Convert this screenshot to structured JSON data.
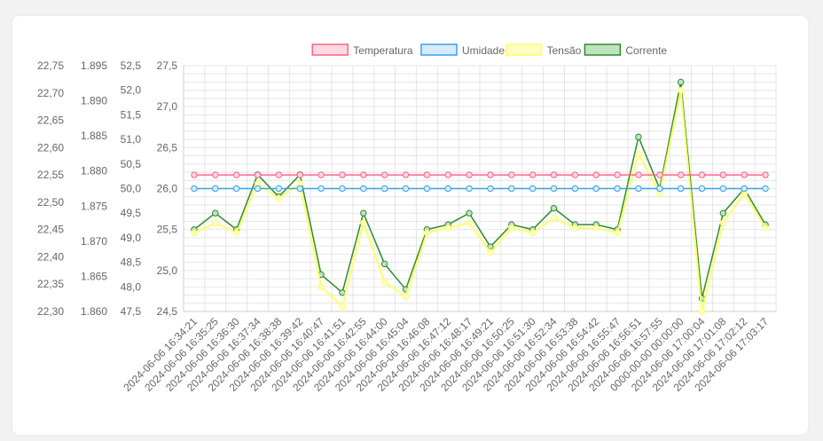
{
  "chart_data": {
    "type": "line",
    "title": "",
    "legend_position": "top",
    "grid": true,
    "categories": [
      "2024-06-06 16:34:21",
      "2024-06-06 16:35:25",
      "2024-06-06 16:36:30",
      "2024-06-06 16:37:34",
      "2024-06-06 16:38:38",
      "2024-06-06 16:39:42",
      "2024-06-06 16:40:47",
      "2024-06-06 16:41:51",
      "2024-06-06 16:42:55",
      "2024-06-06 16:44:00",
      "2024-06-06 16:45:04",
      "2024-06-06 16:46:08",
      "2024-06-06 16:47:12",
      "2024-06-06 16:48:17",
      "2024-06-06 16:49:21",
      "2024-06-06 16:50:25",
      "2024-06-06 16:51:30",
      "2024-06-06 16:52:34",
      "2024-06-06 16:53:38",
      "2024-06-06 16:54:42",
      "2024-06-06 16:55:47",
      "2024-06-06 16:56:51",
      "2024-06-06 16:57:55",
      "0000-00-00 00:00:00",
      "2024-06-06 17:00:04",
      "2024-06-06 17:01:08",
      "2024-06-06 17:02:12",
      "2024-06-06 17:03:17"
    ],
    "axes": [
      {
        "id": "y_temp",
        "ticks": [
          "22,75",
          "22,70",
          "22,65",
          "22,60",
          "22,55",
          "22,50",
          "22,45",
          "22,40",
          "22,35",
          "22,30"
        ],
        "ylim": [
          22.3,
          22.75
        ]
      },
      {
        "id": "y_umid",
        "ticks": [
          "1.895",
          "1.890",
          "1.885",
          "1.880",
          "1.875",
          "1.870",
          "1.865",
          "1.860"
        ],
        "ylim": [
          1.86,
          1.895
        ]
      },
      {
        "id": "y_tensao",
        "ticks": [
          "52,5",
          "52,0",
          "51,5",
          "51,0",
          "50,5",
          "50,0",
          "49,5",
          "49,0",
          "48,5",
          "48,0",
          "47,5"
        ],
        "ylim": [
          47.5,
          52.5
        ]
      },
      {
        "id": "y_corrente",
        "ticks": [
          "27,5",
          "27,0",
          "26,5",
          "26,0",
          "25,5",
          "25,0",
          "24,5"
        ],
        "ylim": [
          24.5,
          27.5
        ]
      }
    ],
    "series": [
      {
        "name": "Temperatura",
        "axis": "y_temp",
        "color": "#ff6384",
        "fill": "#ffd9e1",
        "values": [
          22.55,
          22.55,
          22.55,
          22.55,
          22.55,
          22.55,
          22.55,
          22.55,
          22.55,
          22.55,
          22.55,
          22.55,
          22.55,
          22.55,
          22.55,
          22.55,
          22.55,
          22.55,
          22.55,
          22.55,
          22.55,
          22.55,
          22.55,
          22.55,
          22.55,
          22.55,
          22.55,
          22.55
        ]
      },
      {
        "name": "Umidade",
        "axis": "y_umid",
        "color": "#36a2eb",
        "fill": "#d6ecfb",
        "values": [
          1.8775,
          1.8775,
          1.8775,
          1.8775,
          1.8775,
          1.8775,
          1.8775,
          1.8775,
          1.8775,
          1.8775,
          1.8775,
          1.8775,
          1.8775,
          1.8775,
          1.8775,
          1.8775,
          1.8775,
          1.8775,
          1.8775,
          1.8775,
          1.8775,
          1.8775,
          1.8775,
          1.8775,
          1.8775,
          1.8775,
          1.8775,
          1.8775
        ]
      },
      {
        "name": "Tensão",
        "axis": "y_tensao",
        "color": "#ffff66",
        "fill": "#ffffc2",
        "values": [
          49.1,
          49.3,
          49.1,
          50.1,
          49.8,
          50.1,
          48.0,
          47.6,
          49.3,
          48.1,
          47.8,
          49.1,
          49.2,
          49.3,
          48.7,
          49.2,
          49.1,
          49.4,
          49.2,
          49.2,
          49.1,
          50.7,
          49.9,
          52.0,
          47.5,
          49.3,
          49.9,
          49.2
        ]
      },
      {
        "name": "Corrente",
        "axis": "y_corrente",
        "color": "#2e8b2e",
        "fill": "#bfe3bf",
        "values": [
          25.5,
          25.7,
          25.5,
          26.17,
          25.9,
          26.17,
          24.95,
          24.73,
          25.7,
          25.08,
          24.77,
          25.5,
          25.56,
          25.7,
          25.29,
          25.56,
          25.5,
          25.76,
          25.56,
          25.56,
          25.5,
          26.63,
          26.0,
          27.3,
          24.66,
          25.7,
          26.0,
          25.56
        ]
      }
    ]
  }
}
